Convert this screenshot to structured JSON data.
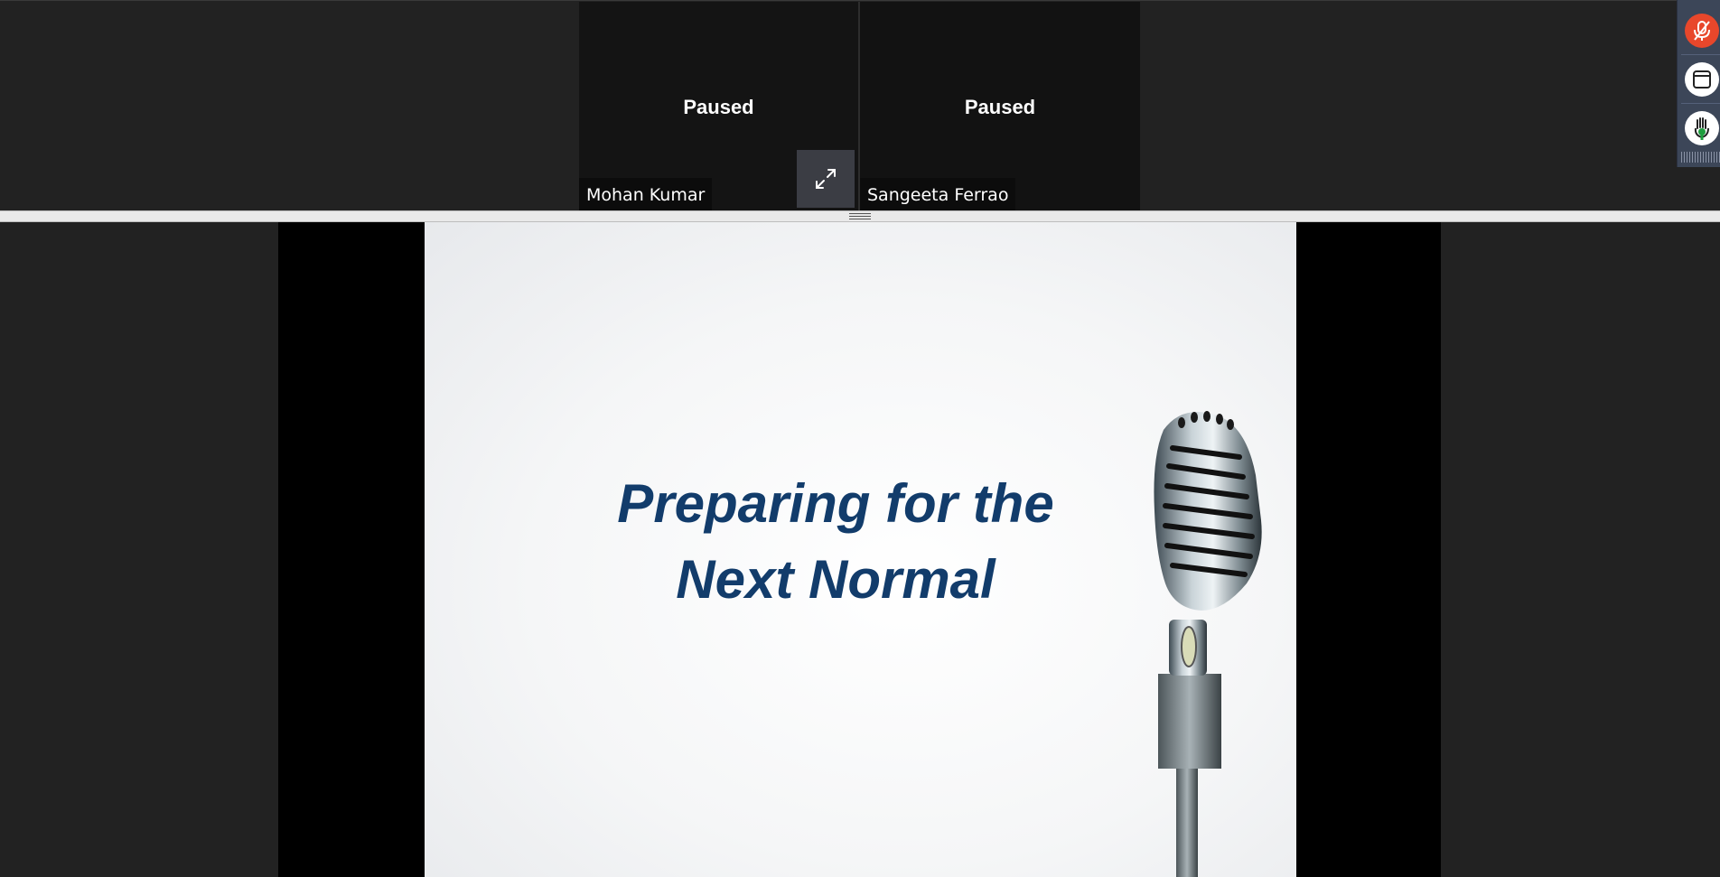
{
  "participants": [
    {
      "name": "Mohan Kumar",
      "status": "Paused"
    },
    {
      "name": "Sangeeta Ferrao",
      "status": "Paused"
    }
  ],
  "slide": {
    "title_line1": "Preparing for the",
    "title_line2": "Next Normal"
  },
  "toolbar": {
    "mic_icon": "mic-muted-icon",
    "window_icon": "window-icon",
    "hand_icon": "raise-hand-icon",
    "mute_color": "#e8472b"
  }
}
